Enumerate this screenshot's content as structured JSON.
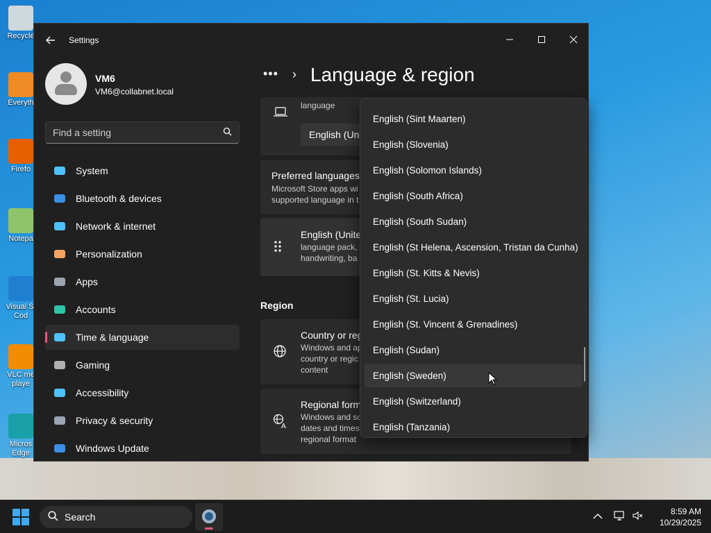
{
  "desktop": {
    "icons": [
      {
        "label": "Recycle",
        "icon": "recycle-bin-icon",
        "color": "#cfd8dc"
      },
      {
        "label": "Everyth",
        "icon": "everything-search-icon",
        "color": "#f08a24"
      },
      {
        "label": "Firefo",
        "icon": "firefox-icon",
        "color": "#e66000"
      },
      {
        "label": "Notepa",
        "icon": "notepad-icon",
        "color": "#8fc46a"
      },
      {
        "label": "Visual St Cod",
        "icon": "vscode-icon",
        "color": "#1f7fd1"
      },
      {
        "label": "VLC me playe",
        "icon": "vlc-icon",
        "color": "#f28c00"
      },
      {
        "label": "Micros Edge",
        "icon": "edge-icon",
        "color": "#1aa0a8"
      }
    ]
  },
  "window": {
    "title": "Settings",
    "controls": {
      "minimize": "—",
      "maximize": "☐",
      "close": "✕"
    }
  },
  "profile": {
    "name": "VM6",
    "email": "VM6@collabnet.local"
  },
  "search": {
    "placeholder": "Find a setting"
  },
  "sidebar": {
    "items": [
      {
        "label": "System",
        "icon": "monitor-icon",
        "color": "#4cc2ff"
      },
      {
        "label": "Bluetooth & devices",
        "icon": "bluetooth-icon",
        "color": "#3a8ee6"
      },
      {
        "label": "Network & internet",
        "icon": "wifi-icon",
        "color": "#4cc2ff"
      },
      {
        "label": "Personalization",
        "icon": "brush-icon",
        "color": "#f4a261"
      },
      {
        "label": "Apps",
        "icon": "apps-icon",
        "color": "#9aa5b1"
      },
      {
        "label": "Accounts",
        "icon": "person-icon",
        "color": "#2ec4a6"
      },
      {
        "label": "Time & language",
        "icon": "globe-clock-icon",
        "color": "#4cc2ff"
      },
      {
        "label": "Gaming",
        "icon": "controller-icon",
        "color": "#b0b0b0"
      },
      {
        "label": "Accessibility",
        "icon": "accessibility-icon",
        "color": "#4cc2ff"
      },
      {
        "label": "Privacy & security",
        "icon": "shield-icon",
        "color": "#9aa5b1"
      },
      {
        "label": "Windows Update",
        "icon": "update-icon",
        "color": "#3a8ee6"
      }
    ],
    "active_index": 6
  },
  "main": {
    "breadcrumb_more": "•••",
    "breadcrumb_sep": "›",
    "title": "Language & region",
    "display_language": {
      "subtitle": "language",
      "value": "English (Uni"
    },
    "preferred": {
      "title": "Preferred languages",
      "line1": "Microsoft Store apps wi",
      "line2": "supported language in t"
    },
    "english_row": {
      "title": "English (Unite",
      "line1": "language pack, ",
      "line2": "handwriting, ba"
    },
    "region_heading": "Region",
    "country": {
      "title": "Country or reg",
      "line1": "Windows and ap",
      "line2": "country or regic",
      "line3": "content"
    },
    "regional_format": {
      "title": "Regional form",
      "line1": "Windows and sc",
      "line2": "dates and times",
      "line3": "regional format"
    }
  },
  "dropdown": {
    "items": [
      "English (Sint Maarten)",
      "English (Slovenia)",
      "English (Solomon Islands)",
      "English (South Africa)",
      "English (South Sudan)",
      "English (St Helena, Ascension, Tristan da Cunha)",
      "English (St. Kitts & Nevis)",
      "English (St. Lucia)",
      "English (St. Vincent & Grenadines)",
      "English (Sudan)",
      "English (Sweden)",
      "English (Switzerland)",
      "English (Tanzania)"
    ],
    "hover_index": 10
  },
  "taskbar": {
    "search_label": "Search",
    "time": "8:59 AM",
    "date": "10/29/2025"
  }
}
